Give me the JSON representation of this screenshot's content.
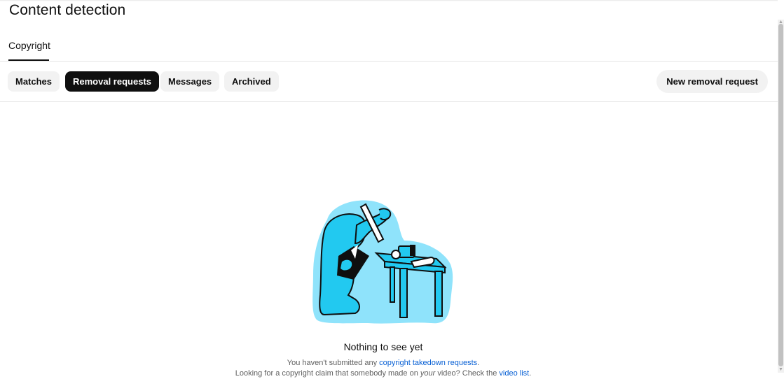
{
  "page": {
    "title": "Content detection"
  },
  "tabs": [
    {
      "label": "Copyright",
      "selected": true
    }
  ],
  "chips": [
    {
      "label": "Matches",
      "selected": false
    },
    {
      "label": "Removal requests",
      "selected": true
    },
    {
      "label": "Messages",
      "selected": false
    },
    {
      "label": "Archived",
      "selected": false
    }
  ],
  "actions": {
    "new_removal_request": "New removal request"
  },
  "empty_state": {
    "title": "Nothing to see yet",
    "line1_prefix": "You haven't submitted any ",
    "line1_link": "copyright takedown requests",
    "line1_suffix": ".",
    "line2_prefix": "Looking for a copyright claim that somebody made on ",
    "line2_emphasis": "your",
    "line2_middle": " video? Check the ",
    "line2_link": "video list",
    "line2_suffix": "."
  },
  "colors": {
    "accent": "#065fd4",
    "illustration_cyan": "#22c9f0",
    "illustration_light": "#8fe3fb"
  }
}
